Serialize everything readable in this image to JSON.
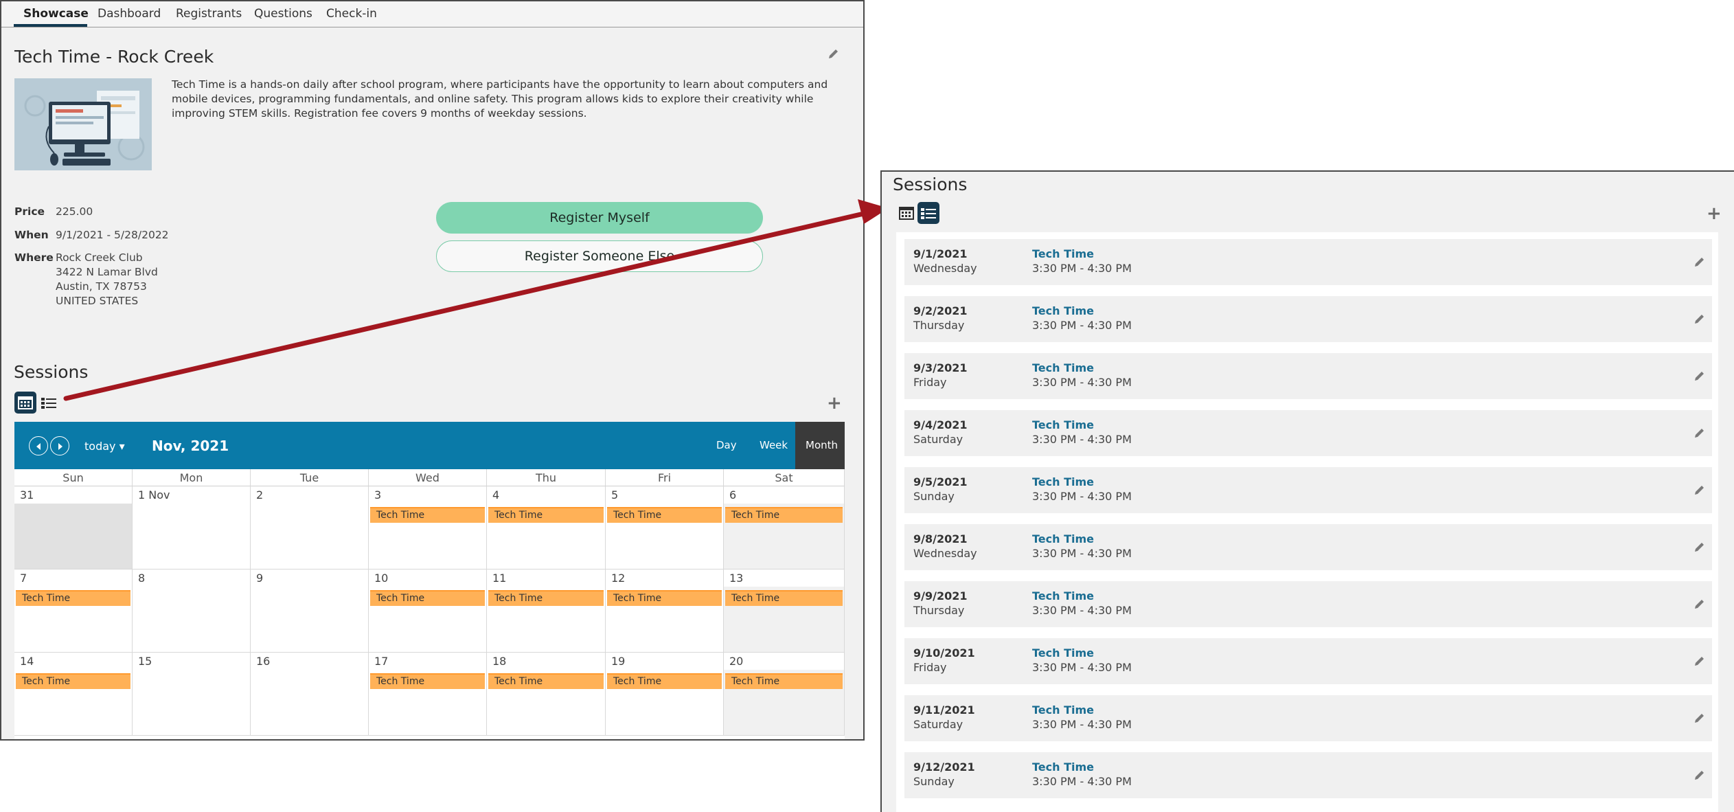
{
  "tabs": [
    "Showcase",
    "Dashboard",
    "Registrants",
    "Questions",
    "Check-in"
  ],
  "event": {
    "title": "Tech Time - Rock Creek",
    "description": "Tech Time is a hands-on daily after school program, where participants have the opportunity to learn about computers and mobile devices, programming fundamentals, and online safety. This program allows kids to explore their creativity while improving STEM skills. Registration fee covers 9 months of weekday sessions.",
    "price_label": "Price",
    "price": "225.00",
    "when_label": "When",
    "when": "9/1/2021 - 5/28/2022",
    "where_label": "Where",
    "where_lines": [
      "Rock Creek Club",
      "3422 N Lamar Blvd",
      "Austin, TX 78753",
      "UNITED STATES"
    ]
  },
  "buttons": {
    "register_myself": "Register Myself",
    "register_someone": "Register Someone Else"
  },
  "sessions_title": "Sessions",
  "calendar": {
    "today_label": "today ▾",
    "month_title": "Nov, 2021",
    "views": [
      "Day",
      "Week",
      "Month"
    ],
    "active_view": "Month",
    "days_of_week": [
      "Sun",
      "Mon",
      "Tue",
      "Wed",
      "Thu",
      "Fri",
      "Sat"
    ],
    "weeks": [
      {
        "days": [
          "31",
          "1 Nov",
          "2",
          "3",
          "4",
          "5",
          "6"
        ],
        "events": [
          null,
          null,
          null,
          "Tech Time",
          "Tech Time",
          "Tech Time",
          "Tech Time"
        ],
        "other_month": [
          true,
          false,
          false,
          false,
          false,
          false,
          false
        ]
      },
      {
        "days": [
          "7",
          "8",
          "9",
          "10",
          "11",
          "12",
          "13"
        ],
        "events": [
          "Tech Time",
          null,
          null,
          "Tech Time",
          "Tech Time",
          "Tech Time",
          "Tech Time"
        ],
        "other_month": [
          false,
          false,
          false,
          false,
          false,
          false,
          false
        ]
      },
      {
        "days": [
          "14",
          "15",
          "16",
          "17",
          "18",
          "19",
          "20"
        ],
        "events": [
          "Tech Time",
          null,
          null,
          "Tech Time",
          "Tech Time",
          "Tech Time",
          "Tech Time"
        ],
        "other_month": [
          false,
          false,
          false,
          false,
          false,
          false,
          false
        ]
      }
    ],
    "colors": {
      "header": "#0a7aa8",
      "event": "#ffb157"
    }
  },
  "session_list": [
    {
      "date": "9/1/2021",
      "day": "Wednesday",
      "title": "Tech Time",
      "time": "3:30 PM - 4:30 PM"
    },
    {
      "date": "9/2/2021",
      "day": "Thursday",
      "title": "Tech Time",
      "time": "3:30 PM - 4:30 PM"
    },
    {
      "date": "9/3/2021",
      "day": "Friday",
      "title": "Tech Time",
      "time": "3:30 PM - 4:30 PM"
    },
    {
      "date": "9/4/2021",
      "day": "Saturday",
      "title": "Tech Time",
      "time": "3:30 PM - 4:30 PM"
    },
    {
      "date": "9/5/2021",
      "day": "Sunday",
      "title": "Tech Time",
      "time": "3:30 PM - 4:30 PM"
    },
    {
      "date": "9/8/2021",
      "day": "Wednesday",
      "title": "Tech Time",
      "time": "3:30 PM - 4:30 PM"
    },
    {
      "date": "9/9/2021",
      "day": "Thursday",
      "title": "Tech Time",
      "time": "3:30 PM - 4:30 PM"
    },
    {
      "date": "9/10/2021",
      "day": "Friday",
      "title": "Tech Time",
      "time": "3:30 PM - 4:30 PM"
    },
    {
      "date": "9/11/2021",
      "day": "Saturday",
      "title": "Tech Time",
      "time": "3:30 PM - 4:30 PM"
    },
    {
      "date": "9/12/2021",
      "day": "Sunday",
      "title": "Tech Time",
      "time": "3:30 PM - 4:30 PM"
    }
  ],
  "icons": {
    "edit": "pencil-icon",
    "add": "plus-icon",
    "calendar_view": "calendar-icon",
    "list_view": "list-icon",
    "prev": "chevron-left-icon",
    "next": "chevron-right-icon"
  },
  "colors": {
    "annotation_arrow": "#a3171f",
    "accent_dark": "#173a50",
    "register_button": "#80d5b1"
  }
}
